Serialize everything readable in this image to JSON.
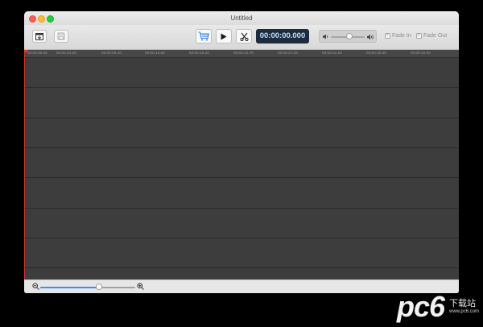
{
  "window": {
    "title": "Untitled"
  },
  "toolbar": {
    "timecode": "00:00:00.000",
    "fade_in_label": "Fade In",
    "fade_out_label": "Fade Out",
    "volume_level": 0.55
  },
  "ruler": {
    "ticks": [
      "00:00:00.00",
      "00:00:04.55",
      "00:00:09.10",
      "00:00:13.65",
      "00:00:18.20",
      "00:00:22.75",
      "00:00:27.29",
      "00:00:31.84",
      "00:00:36.39",
      "00:00:40.94"
    ]
  },
  "footer": {
    "zoom_level": 0.62
  },
  "watermark": {
    "brand": "pc6",
    "cn": "下载站",
    "url": "www.pc6.com"
  },
  "colors": {
    "accent": "#3b8cff",
    "timecode_bg": "#1d2b3d",
    "timeline_bg": "#3d3d3d",
    "playhead": "#e03a3a"
  },
  "icons": [
    "import-icon",
    "save-icon",
    "store-cart-icon",
    "play-icon",
    "scissors-icon",
    "volume-low-icon",
    "volume-high-icon",
    "zoom-out-icon",
    "zoom-in-icon"
  ]
}
